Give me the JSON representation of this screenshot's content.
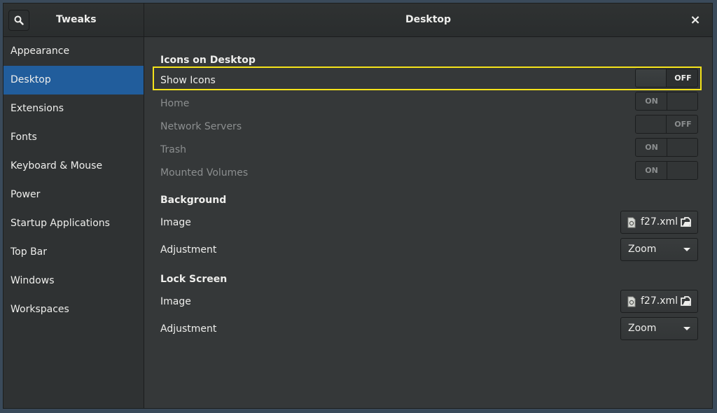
{
  "header": {
    "app_title": "Tweaks",
    "page_title": "Desktop",
    "close_symbol": "×",
    "search_icon": "search-icon"
  },
  "sidebar": {
    "items": [
      {
        "label": "Appearance",
        "active": false
      },
      {
        "label": "Desktop",
        "active": true
      },
      {
        "label": "Extensions",
        "active": false
      },
      {
        "label": "Fonts",
        "active": false
      },
      {
        "label": "Keyboard & Mouse",
        "active": false
      },
      {
        "label": "Power",
        "active": false
      },
      {
        "label": "Startup Applications",
        "active": false
      },
      {
        "label": "Top Bar",
        "active": false
      },
      {
        "label": "Windows",
        "active": false
      },
      {
        "label": "Workspaces",
        "active": false
      }
    ]
  },
  "icons_section": {
    "title": "Icons on Desktop",
    "rows": [
      {
        "label": "Show Icons",
        "state": "OFF",
        "sensitive": true,
        "highlighted": true
      },
      {
        "label": "Home",
        "state": "ON",
        "sensitive": false
      },
      {
        "label": "Network Servers",
        "state": "OFF",
        "sensitive": false
      },
      {
        "label": "Trash",
        "state": "ON",
        "sensitive": false
      },
      {
        "label": "Mounted Volumes",
        "state": "ON",
        "sensitive": false
      }
    ]
  },
  "background_section": {
    "title": "Background",
    "image_label": "Image",
    "image_file": "f27.xml",
    "adjustment_label": "Adjustment",
    "adjustment_value": "Zoom"
  },
  "lock_section": {
    "title": "Lock Screen",
    "image_label": "Image",
    "image_file": "f27.xml",
    "adjustment_label": "Adjustment",
    "adjustment_value": "Zoom"
  },
  "colors": {
    "accent": "#215d9c",
    "highlight": "#f5e31a",
    "background": "#353839"
  }
}
